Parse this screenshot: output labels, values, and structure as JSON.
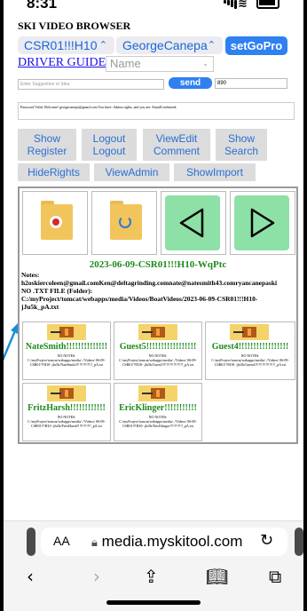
{
  "status_bar": {
    "time": "8:31"
  },
  "app": {
    "title": "SKI VIDEO BROWSER",
    "boat_select": "CSR01!!!H10",
    "driver_select": "GeorgeCanepa",
    "setgopro_label": "setGoPro",
    "driver_guide_label": "DRIVER GUIDE",
    "name_placeholder": "Name",
    "suggestion_placeholder": "Enter Suggestion or Idea",
    "send_label": "send",
    "count_value": "890",
    "status_message": "Password Valid, Welcome! georgecanepa@gmail.com You have: Admin rights, and you are: EmailConfirmed,"
  },
  "buttons": [
    {
      "l1": "Show",
      "l2": "Register"
    },
    {
      "l1": "Logout",
      "l2": "Logout"
    },
    {
      "l1": "ViewEdit",
      "l2": "Comment"
    },
    {
      "l1": "Show",
      "l2": "Search"
    },
    {
      "l1": "HideRights",
      "l2": ""
    },
    {
      "l1": "ViewAdmin",
      "l2": ""
    },
    {
      "l1": "ShowImport",
      "l2": ""
    }
  ],
  "media": {
    "title": "2023-06-09-CSR01!!!H10-WqPtc",
    "notes_label": "Notes:",
    "notes_line1": "h2oskiercoleen@gmail.comKen@deltagrinding.comnate@natesmith43.comryancanepaski",
    "notes_line2": "NO .TXT FILE (Folder):",
    "notes_line3": "C:/myProject/tomcat/webapps/media/Videos/BoatVideos/2023-06-09-CSR01!!!H10-",
    "notes_line4": "jJu5k_pA.txt"
  },
  "users": [
    {
      "name": "NateSmith!!!!!!!!!!!!!!",
      "note_label": "NO NOTES:",
      "note_path": "C:/myProject/tomcat/webapps/media/../Videos/ 06-09-CSR01!!!H10- jJu5k/NateSmith!!!!!!!!!!!!!!_pA.txt"
    },
    {
      "name": "Guest5!!!!!!!!!!!!!!!!!",
      "note_label": "NO NOTES:",
      "note_path": "C:/myProject/tomcat/webapps/media/../Videos/ 06-09-CSR01!!!H10- jJu5k/Guest5!!!!!!!!!!!!!!!!!_pA.txt"
    },
    {
      "name": "Guest4!!!!!!!!!!!!!!!!!",
      "note_label": "NO NOTES:",
      "note_path": "C:/myProject/tomcat/webapps/media/../Videos/ 06-09-CSR01!!!H10- jJu5k/Guest4!!!!!!!!!!!!!!!!!_pA.txt"
    },
    {
      "name": "FritzHarsh!!!!!!!!!!!!",
      "note_label": "NO NOTES:",
      "note_path": "C:/myProject/tomcat/webapps/media/../Videos/ 06-09-CSR01!!!H10- jJu5k/FritzHarsh!!!!!!!!!!!!_pA.txt"
    },
    {
      "name": "EricKlinger!!!!!!!!!!!",
      "note_label": "NO NOTES:",
      "note_path": "C:/myProject/tomcat/webapps/media/../Videos/ 06-09-CSR01!!!H10- jJu5k/EricKlinger!!!!!!!!!!!_pA.txt"
    }
  ],
  "safari": {
    "aa_label": "AA",
    "url": "media.myskitool.com"
  },
  "colors": {
    "link_blue": "#1d0ee8",
    "button_blue": "#2f80f0",
    "title_green": "#1c8a1c",
    "nav_green": "#8de0a6",
    "folder_yellow": "#f2c45c"
  },
  "icons": [
    "signal-icon",
    "wifi-icon",
    "battery-icon",
    "folder-record-icon",
    "folder-refresh-icon",
    "prev-triangle-icon",
    "next-triangle-icon",
    "ski-boat-icon",
    "lock-icon",
    "reload-icon",
    "back-icon",
    "forward-icon",
    "share-icon",
    "bookmarks-icon",
    "tabs-icon"
  ]
}
